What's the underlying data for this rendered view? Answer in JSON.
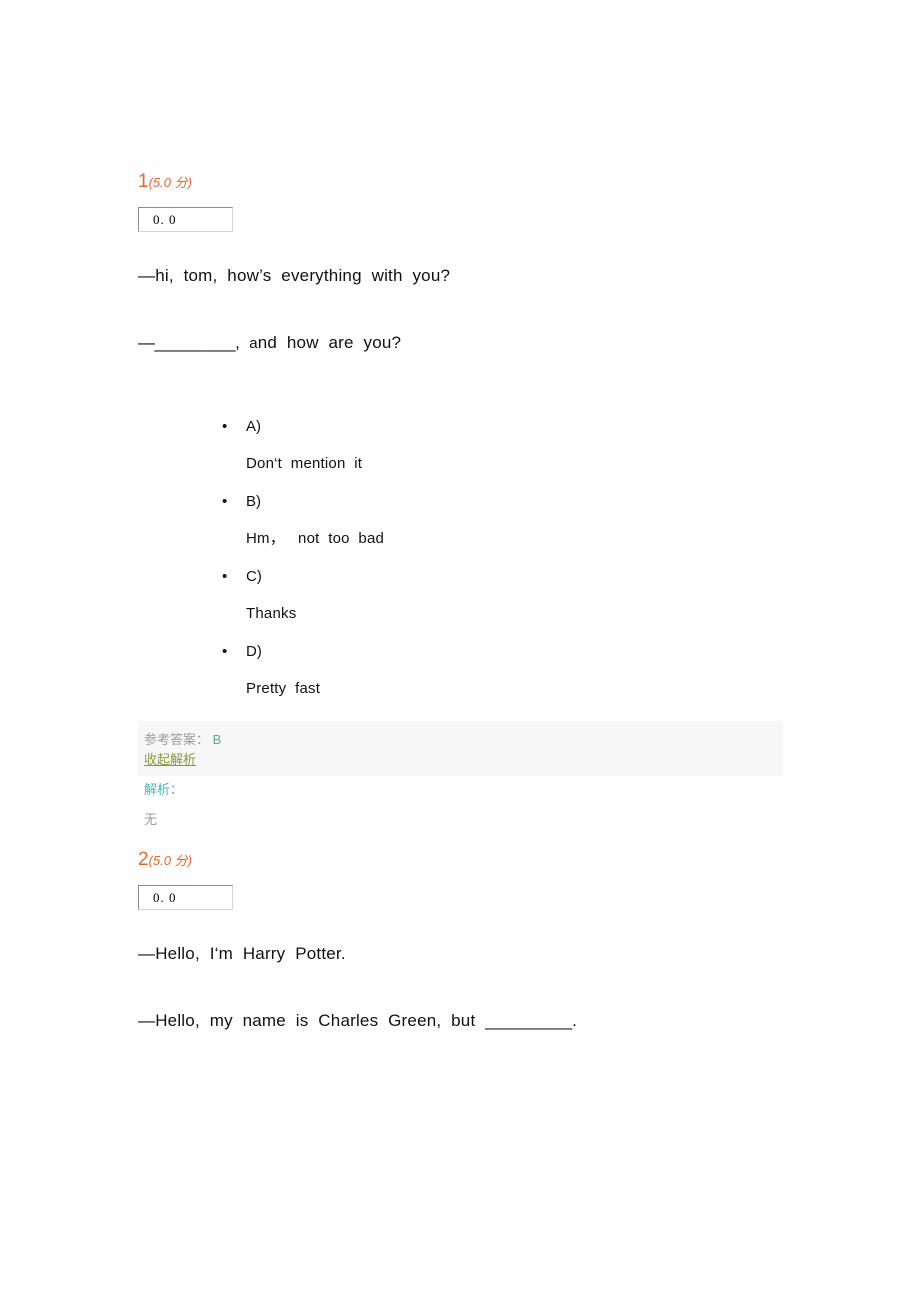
{
  "meta": {
    "accent_orange": "#e8662a",
    "answer_value_color": "#5cab9a",
    "toggle_link_color": "#8a9a3c",
    "explain_title_color": "#4cb3ae",
    "muted_gray": "#9b9b9b",
    "answer_bar_bg": "#f7f7f7"
  },
  "questions": [
    {
      "number": "1",
      "score": "(5.0 分)",
      "score_input_value": "0. 0",
      "score_input_placeholder": "0. 0",
      "lines": [
        "—hi,  tom,  how’s  everything  with  you?",
        "—_________,"
      ],
      "line2_tail_small": "a",
      "line2_tail": "nd  how  are  you?",
      "options": [
        {
          "label": "A)",
          "text": "Don‘t  mention  it"
        },
        {
          "label": "B)",
          "text": "Hm，   not  too  bad"
        },
        {
          "label": "C)",
          "text": "Thanks"
        },
        {
          "label": "D)",
          "text": "Pretty  fast"
        }
      ],
      "answer_label": "参考答案：",
      "answer_value": "B",
      "toggle_label": "收起解析",
      "explain_title": "解析：",
      "explain_body": "无"
    },
    {
      "number": "2",
      "score": "(5.0 分)",
      "score_input_value": "0. 0",
      "score_input_placeholder": "0. 0",
      "lines": [
        "—Hello,  I‘m  Harry  Potter.",
        "—Hello,  my  name  is  Charles  Green,  but  _________."
      ]
    }
  ]
}
